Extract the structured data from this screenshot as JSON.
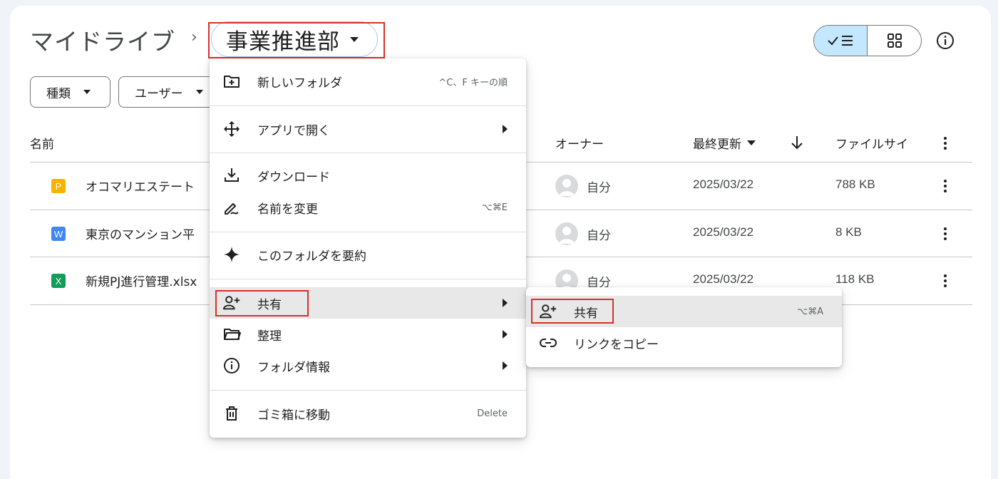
{
  "header": {
    "breadcrumb_root": "マイドライブ",
    "breadcrumb_sep": "›",
    "current_folder": "事業推進部"
  },
  "filters": [
    {
      "label": "種類"
    },
    {
      "label": "ユーザー"
    }
  ],
  "table": {
    "columns": {
      "name": "名前",
      "owner": "オーナー",
      "modified": "最終更新",
      "size": "ファイルサイ"
    },
    "rows": [
      {
        "icon_letter": "P",
        "icon_color": "#f4b400",
        "name": "オコマリエステート",
        "owner": "自分",
        "modified": "2025/03/22",
        "size": "788 KB"
      },
      {
        "icon_letter": "W",
        "icon_color": "#4285f4",
        "name": "東京のマンション平",
        "owner": "自分",
        "modified": "2025/03/22",
        "size": "8 KB"
      },
      {
        "icon_letter": "X",
        "icon_color": "#0f9d58",
        "name": "新規PJ進行管理.xlsx",
        "owner": "自分",
        "modified": "2025/03/22",
        "size": "118 KB"
      }
    ]
  },
  "folder_menu": {
    "items": [
      {
        "label": "新しいフォルダ",
        "shortcut": "^C、F キーの順",
        "icon": "new-folder-icon"
      },
      {
        "label": "アプリで開く",
        "icon": "open-with-icon"
      },
      {
        "label": "ダウンロード",
        "icon": "download-icon"
      },
      {
        "label": "名前を変更",
        "shortcut": "⌥⌘E",
        "icon": "rename-icon"
      },
      {
        "label": "このフォルダを要約",
        "icon": "sparkle-icon"
      },
      {
        "label": "共有",
        "icon": "share-icon"
      },
      {
        "label": "整理",
        "icon": "organize-folder-icon"
      },
      {
        "label": "フォルダ情報",
        "icon": "info-icon"
      },
      {
        "label": "ゴミ箱に移動",
        "shortcut": "Delete",
        "icon": "trash-icon"
      }
    ]
  },
  "share_submenu": {
    "items": [
      {
        "label": "共有",
        "shortcut": "⌥⌘A",
        "icon": "share-icon"
      },
      {
        "label": "リンクをコピー",
        "icon": "link-icon"
      }
    ]
  },
  "colors": {
    "highlight": "#d93025",
    "menu_hover": "#e8e8e8",
    "toggle_active": "#c2e7ff"
  }
}
